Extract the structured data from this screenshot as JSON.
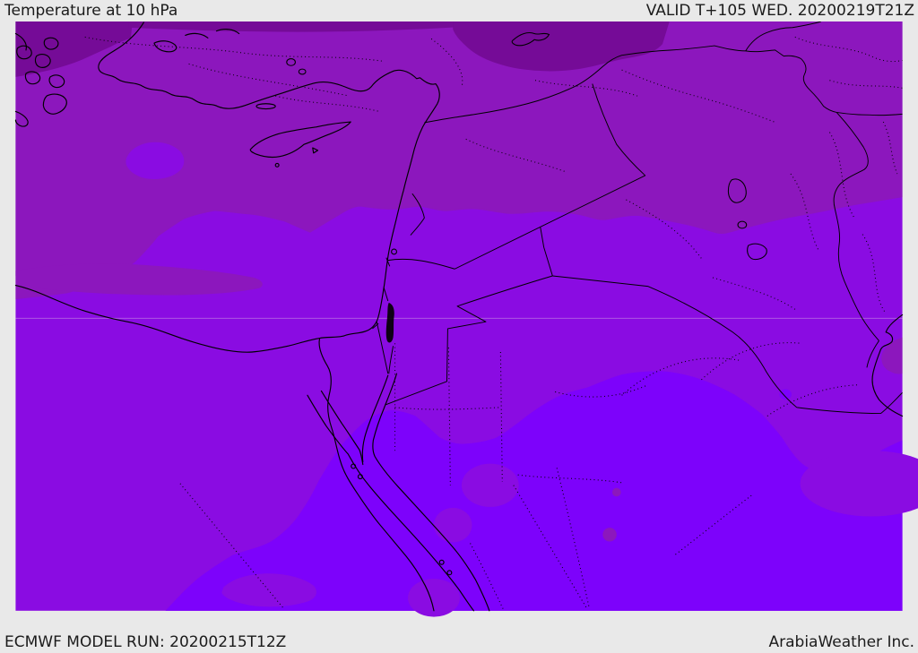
{
  "header": {
    "title": "Temperature at 10 hPa",
    "valid_time": "VALID T+105 WED. 20200219T21Z"
  },
  "footer": {
    "model_run": "ECMWF MODEL RUN: 20200215T12Z",
    "brand": "ArabiaWeather Inc."
  },
  "map": {
    "region": "Middle East",
    "parameter": "Temperature at 10 hPa",
    "colors": {
      "band_darkest": "#750b97",
      "band_dark": "#8c17bd",
      "band_mid": "#8a0ce2",
      "band_bright": "#7d02fb",
      "coastline": "#000000",
      "gridline": "#cf9fe2",
      "bar_bg": "#e9e9e9",
      "bar_text": "#1b1b1b"
    }
  }
}
